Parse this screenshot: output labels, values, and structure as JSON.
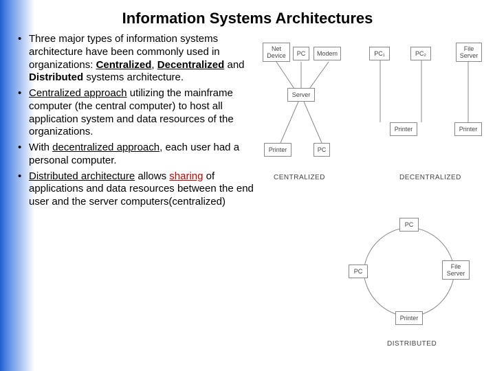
{
  "title": "Information Systems Architectures",
  "bullets": {
    "b1_pre": "Three major types of information systems architecture have been commonly used in organizations: ",
    "b1_bold1": "Centralized",
    "b1_mid1": ", ",
    "b1_bold2": "Decentralized",
    "b1_mid2": " and ",
    "b1_bold3": "Distributed",
    "b1_post": " systems architecture.",
    "b2_link": "Centralized approach",
    "b2_rest": " utilizing the mainframe computer (the central computer) to host all application system and data resources of the organizations.",
    "b3_pre": "With ",
    "b3_link": "decentralized approach",
    "b3_rest": ", each user had a personal computer.",
    "b4_link": "Distributed architecture",
    "b4_mid": " allows ",
    "b4_share": "sharing",
    "b4_rest": " of applications and data resources between the end user and the server computers(centralized)"
  },
  "diagrams": {
    "centralized": {
      "nodes": {
        "net": "Net\nDevice",
        "pc": "PC",
        "modem": "Modem",
        "server": "Server",
        "printer": "Printer",
        "pc2": "PC"
      },
      "label": "CENTRALIZED"
    },
    "decentralized": {
      "nodes": {
        "pc1": "PC₁",
        "pc2": "PC₂",
        "file": "File\nServer",
        "printer1": "Printer",
        "printer2": "Printer"
      },
      "label": "DECENTRALIZED"
    },
    "distributed": {
      "nodes": {
        "pc_top": "PC",
        "pc_left": "PC",
        "file": "File\nServer",
        "printer": "Printer"
      },
      "label": "DISTRIBUTED"
    }
  }
}
